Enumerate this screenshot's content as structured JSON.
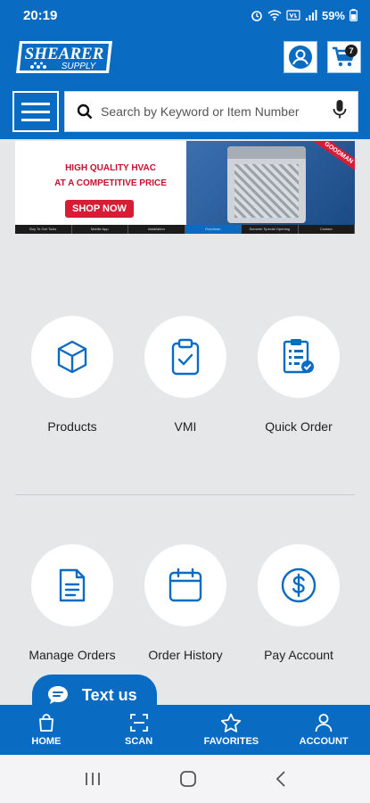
{
  "status_bar": {
    "time": "20:19",
    "battery": "59%"
  },
  "header": {
    "logo_line1": "SHEARER",
    "logo_line2": "SUPPLY",
    "cart_count": "7"
  },
  "search": {
    "placeholder": "Search by Keyword or Item Number"
  },
  "banner": {
    "headline_line1": "HIGH QUALITY HVAC",
    "headline_line2": "AT A COMPETITIVE PRICE",
    "cta": "SHOP NOW",
    "corner_tag": "GOODMAN",
    "tabs": [
      "Buy To Get Tools",
      "Mobile App",
      "Installation",
      "Goodman",
      "Summer Special Opening",
      "Contact"
    ]
  },
  "tiles": [
    {
      "label": "Products",
      "icon": "box-icon"
    },
    {
      "label": "VMI",
      "icon": "clipboard-check-icon"
    },
    {
      "label": "Quick Order",
      "icon": "order-list-icon"
    },
    {
      "label": "Manage Orders",
      "icon": "document-icon"
    },
    {
      "label": "Order History",
      "icon": "calendar-icon"
    },
    {
      "label": "Pay Account",
      "icon": "dollar-icon"
    }
  ],
  "chat": {
    "label": "Text us"
  },
  "bottom_nav": [
    {
      "label": "HOME",
      "icon": "shopping-bag-icon"
    },
    {
      "label": "SCAN",
      "icon": "scan-icon"
    },
    {
      "label": "FAVORITES",
      "icon": "star-icon"
    },
    {
      "label": "ACCOUNT",
      "icon": "user-icon"
    }
  ],
  "colors": {
    "brand_blue": "#0a6bc2",
    "background": "#e6e7e9",
    "banner_red": "#d71c36"
  }
}
